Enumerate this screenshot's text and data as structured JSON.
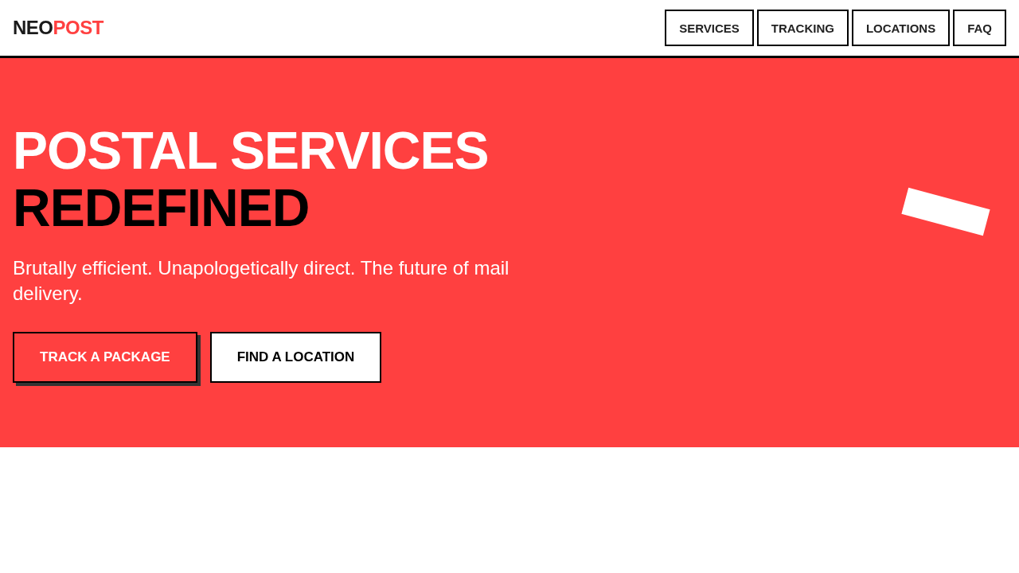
{
  "header": {
    "logo": {
      "main": "NEO",
      "accent": "POST"
    },
    "nav": [
      {
        "label": "SERVICES"
      },
      {
        "label": "TRACKING"
      },
      {
        "label": "LOCATIONS"
      },
      {
        "label": "FAQ"
      }
    ]
  },
  "hero": {
    "title_lines": [
      {
        "text": "POSTAL SERVICES",
        "kind": "light"
      },
      {
        "text": "REDEFINED",
        "kind": "dark"
      }
    ],
    "subtitle": "Brutally efficient. Unapologetically direct. The future of mail delivery.",
    "buttons": [
      {
        "label": "TRACK A PACKAGE",
        "kind": "primary"
      },
      {
        "label": "FIND A LOCATION",
        "kind": "secondary"
      }
    ]
  }
}
